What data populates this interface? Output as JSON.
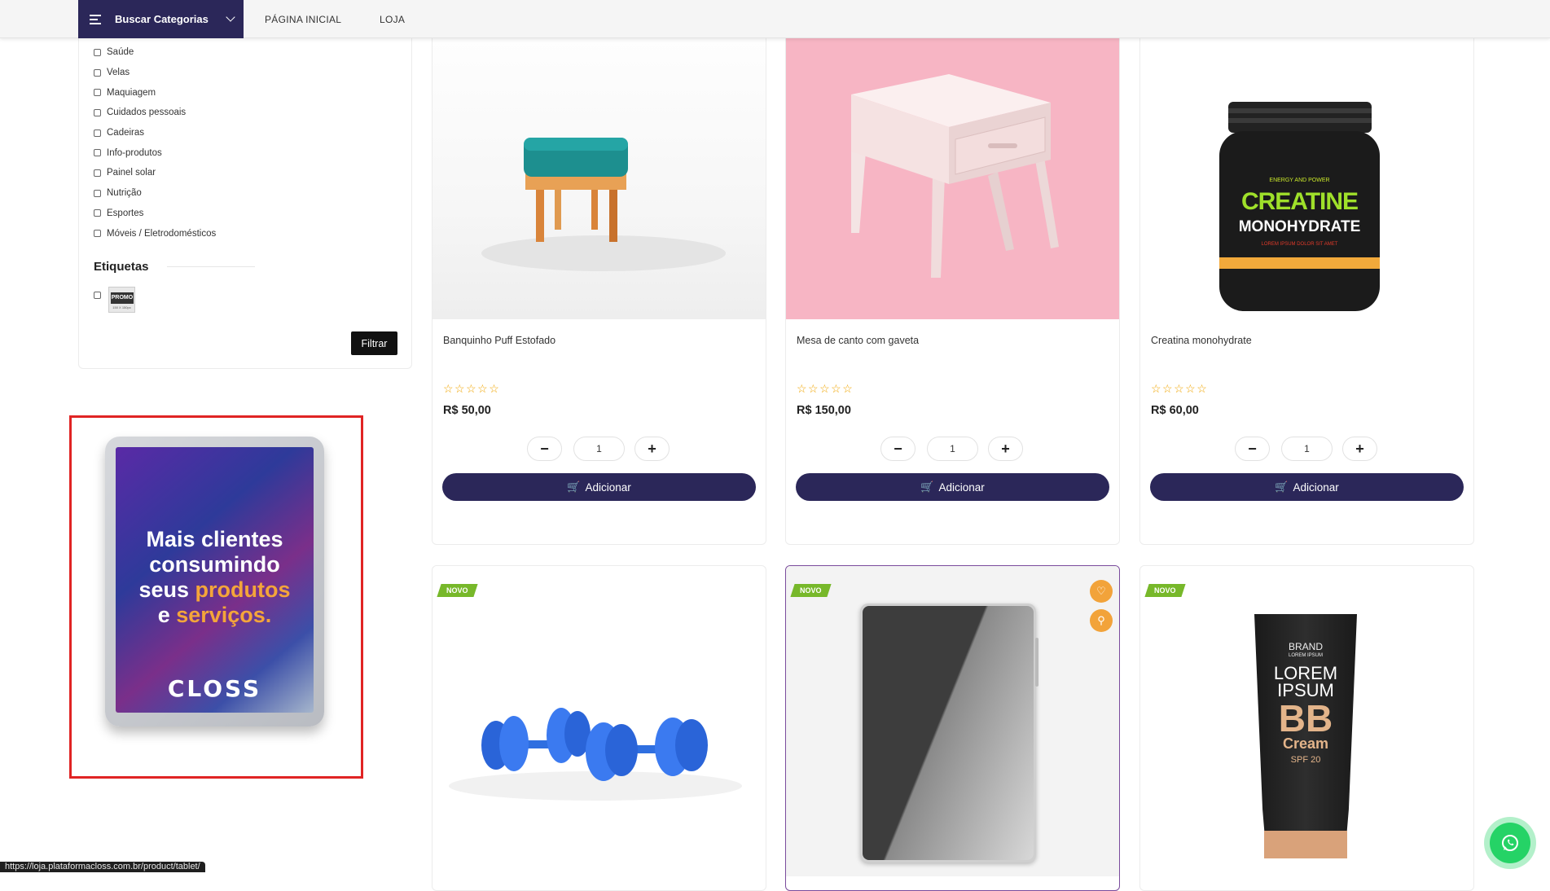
{
  "header": {
    "category_button": "Buscar Categorias",
    "nav": [
      "PÁGINA INICIAL",
      "LOJA"
    ]
  },
  "sidebar": {
    "categories": [
      "Saúde",
      "Velas",
      "Maquiagem",
      "Cuidados pessoais",
      "Cadeiras",
      "Info-produtos",
      "Painel solar",
      "Nutrição",
      "Esportes",
      "Móveis / Eletrodomésticos"
    ],
    "tags_title": "Etiquetas",
    "tag_image_text": "PROMO",
    "tag_image_size": "150 X 150px",
    "filter_button": "Filtrar"
  },
  "ad": {
    "line1": "Mais clientes",
    "line2": "consumindo",
    "line3a": "seus ",
    "line3b": "produtos",
    "line4a": "e ",
    "line4b": "serviços.",
    "logo": "CLOSS"
  },
  "products": [
    {
      "name": "Banquinho Puff Estofado",
      "price": "R$ 50,00",
      "qty": "1",
      "stars": "☆☆☆☆☆",
      "button": "Adicionar"
    },
    {
      "name": "Mesa de canto com gaveta",
      "price": "R$ 150,00",
      "qty": "1",
      "stars": "☆☆☆☆☆",
      "button": "Adicionar"
    },
    {
      "name": "Creatina monohydrate",
      "price": "R$ 60,00",
      "qty": "1",
      "stars": "☆☆☆☆☆",
      "button": "Adicionar"
    }
  ],
  "product_images": {
    "creatine_top": "ENERGY AND POWER",
    "creatine_main": "CREATINE",
    "creatine_sub": "MONOHYDRATE",
    "creatine_small": "LOREM IPSUM DOLOR SIT AMET",
    "bb_brand": "BRAND",
    "bb_lorem_small": "LOREM IPSUM",
    "bb_lorem": "LOREM",
    "bb_ipsum": "IPSUM",
    "bb_bb": "BB",
    "bb_cream": "Cream",
    "bb_spf": "SPF 20"
  },
  "badges": {
    "new": "NOVO"
  },
  "qty_controls": {
    "minus": "−",
    "plus": "+"
  },
  "statusbar": "https://loja.plataformacloss.com.br/product/tablet/",
  "colors": {
    "primary": "#2b2759",
    "badge": "#77b82a",
    "accent": "#f2a33a",
    "ad_border": "#e02424"
  }
}
